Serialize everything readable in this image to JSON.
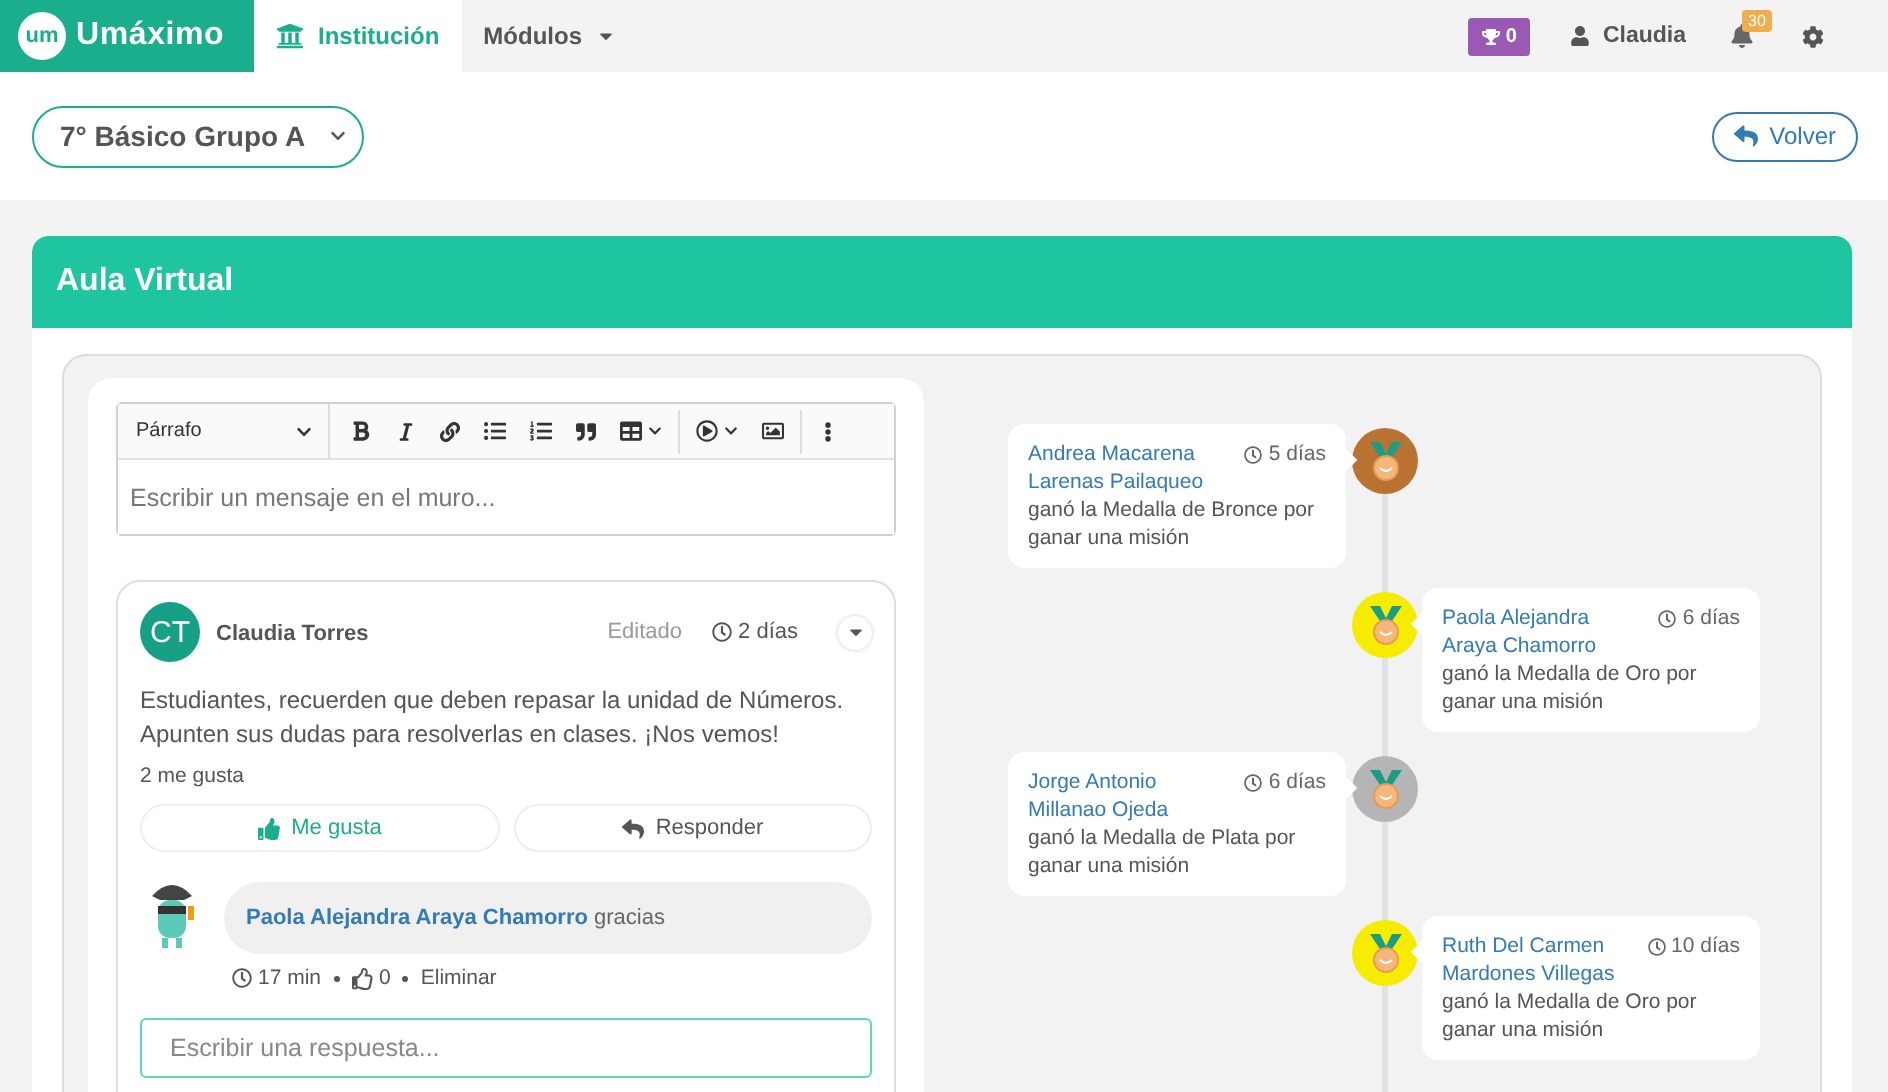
{
  "nav": {
    "logo_mark": "um",
    "logo_text": "Umáximo",
    "tabs": [
      {
        "kind": "icon",
        "label": "Institución",
        "selected": true
      },
      {
        "kind": "menu",
        "label": "Módulos",
        "selected": false
      }
    ],
    "trophies": "0",
    "user": "Claudia",
    "notifications": "30"
  },
  "toolbar": {
    "course_select": "7° Básico Grupo A",
    "back_button": "Volver"
  },
  "panel": {
    "title": "Aula Virtual"
  },
  "editor": {
    "format": "Párrafo",
    "placeholder": "Escribir un mensaje en el muro..."
  },
  "post": {
    "avatar": "CT",
    "author": "Claudia Torres",
    "edited": "Editado",
    "time": "2 días",
    "body": "Estudiantes, recuerden que deben repasar la unidad de Números. Apunten sus dudas para resolverlas en clases. ¡Nos vemos!",
    "likes": "2 me gusta",
    "like_button": {
      "label": "Me gusta",
      "selected": true
    },
    "reply_button": "Responder",
    "comments": [
      {
        "author": "Paola Alejandra Araya Chamorro",
        "text": "gracias",
        "time": "17 min",
        "likes": "0",
        "delete": "Eliminar"
      }
    ],
    "reply_placeholder": "Escribir una respuesta..."
  },
  "timeline": [
    {
      "kind": "left",
      "name": "Andrea Macarena Larenas Pailaqueo",
      "text": "ganó la Medalla de Bronce por ganar una misión",
      "time": "5 días",
      "color": "#b87333"
    },
    {
      "kind": "right",
      "name": "Paola Alejandra Araya Chamorro",
      "text": "ganó la Medalla de Oro por ganar una misión",
      "time": "6 días",
      "color": "#f5ec00"
    },
    {
      "kind": "left",
      "name": "Jorge Antonio Millanao Ojeda",
      "text": "ganó la Medalla de Plata por ganar una misión",
      "time": "6 días",
      "color": "#b5b5b5"
    },
    {
      "kind": "right",
      "name": "Ruth Del Carmen Mardones Villegas",
      "text": "ganó la Medalla de Oro por ganar una misión",
      "time": "10 días",
      "color": "#f5ec00"
    }
  ]
}
